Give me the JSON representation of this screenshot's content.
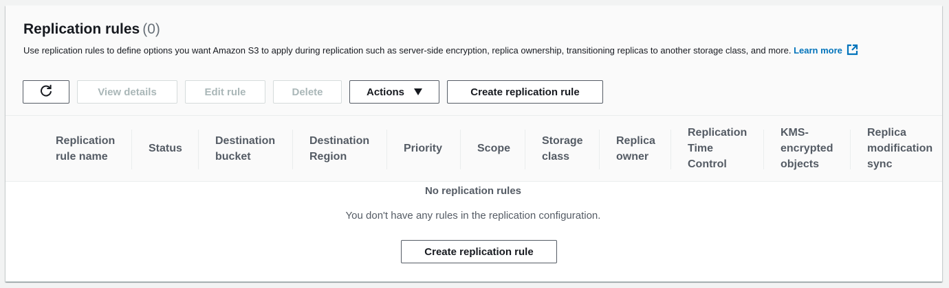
{
  "header": {
    "title": "Replication rules",
    "count": "(0)",
    "description": "Use replication rules to define options you want Amazon S3 to apply during replication such as server-side encryption, replica ownership, transitioning replicas to another storage class, and more.",
    "learn_more": "Learn more"
  },
  "toolbar": {
    "refresh_icon": "refresh-icon",
    "view_details": "View details",
    "edit_rule": "Edit rule",
    "delete": "Delete",
    "actions": "Actions",
    "create_rule": "Create replication rule"
  },
  "table": {
    "columns": [
      [
        "Replication",
        "rule name"
      ],
      [
        "Status"
      ],
      [
        "Destination",
        "bucket"
      ],
      [
        "Destination",
        "Region"
      ],
      [
        "Priority"
      ],
      [
        "Scope"
      ],
      [
        "Storage",
        "class"
      ],
      [
        "Replica",
        "owner"
      ],
      [
        "Replication",
        "Time",
        "Control"
      ],
      [
        "KMS-",
        "encrypted",
        "objects"
      ],
      [
        "Replica",
        "modification",
        "sync"
      ]
    ]
  },
  "empty_state": {
    "title": "No replication rules",
    "description": "You don't have any rules in the replication configuration.",
    "button": "Create replication rule"
  },
  "colors": {
    "link": "#0073bb",
    "text": "#16191f",
    "muted": "#545b64",
    "disabled": "#aab7b8"
  }
}
